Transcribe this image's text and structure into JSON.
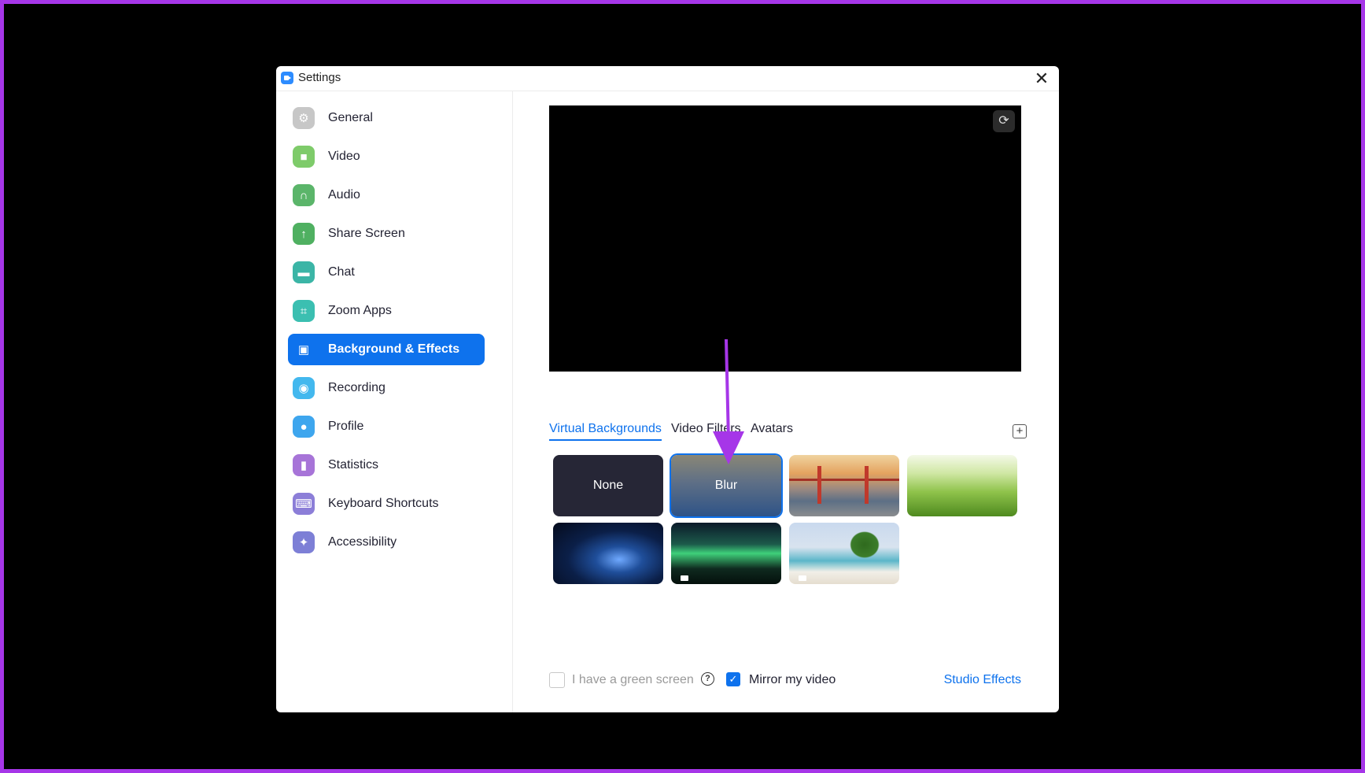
{
  "window": {
    "title": "Settings"
  },
  "sidebar": {
    "items": [
      {
        "label": "General",
        "icon": "gear-icon",
        "color": "#c7c7c7",
        "active": false
      },
      {
        "label": "Video",
        "icon": "video-camera-icon",
        "color": "#7ecb6a",
        "active": false
      },
      {
        "label": "Audio",
        "icon": "headphones-icon",
        "color": "#5bb56a",
        "active": false
      },
      {
        "label": "Share Screen",
        "icon": "share-screen-icon",
        "color": "#4fb061",
        "active": false
      },
      {
        "label": "Chat",
        "icon": "chat-bubble-icon",
        "color": "#3bb5a6",
        "active": false
      },
      {
        "label": "Zoom Apps",
        "icon": "apps-icon",
        "color": "#3bbfb1",
        "active": false
      },
      {
        "label": "Background & Effects",
        "icon": "person-portrait-icon",
        "color": "#ffffff",
        "active": true
      },
      {
        "label": "Recording",
        "icon": "record-icon",
        "color": "#43b8ee",
        "active": false
      },
      {
        "label": "Profile",
        "icon": "user-icon",
        "color": "#3ea6ee",
        "active": false
      },
      {
        "label": "Statistics",
        "icon": "bar-chart-icon",
        "color": "#a774d8",
        "active": false
      },
      {
        "label": "Keyboard Shortcuts",
        "icon": "keyboard-icon",
        "color": "#8c7ed8",
        "active": false
      },
      {
        "label": "Accessibility",
        "icon": "accessibility-icon",
        "color": "#7d7fd6",
        "active": false
      }
    ]
  },
  "tabs": [
    {
      "label": "Virtual Backgrounds",
      "active": true
    },
    {
      "label": "Video Filters",
      "active": false
    },
    {
      "label": "Avatars",
      "active": false
    }
  ],
  "backgrounds": [
    {
      "label": "None",
      "selected": false
    },
    {
      "label": "Blur",
      "selected": true
    }
  ],
  "options": {
    "green_screen_label": "I have a green screen",
    "green_screen_checked": false,
    "mirror_label": "Mirror my video",
    "mirror_checked": true,
    "studio_effects_label": "Studio Effects"
  },
  "colors": {
    "accent": "#0e72ed",
    "annotation_arrow": "#a636e8"
  }
}
